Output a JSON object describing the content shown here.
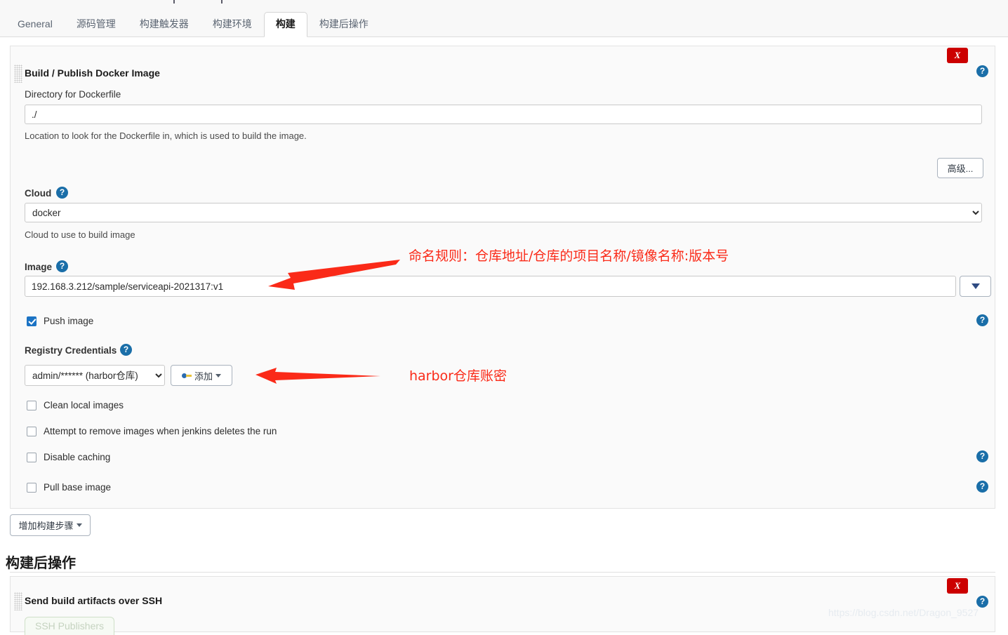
{
  "window": {
    "top_fragment_left": "|",
    "top_fragment_right": "|"
  },
  "tabs": [
    {
      "label": "General",
      "active": false
    },
    {
      "label": "源码管理",
      "active": false
    },
    {
      "label": "构建触发器",
      "active": false
    },
    {
      "label": "构建环境",
      "active": false
    },
    {
      "label": "构建",
      "active": true
    },
    {
      "label": "构建后操作",
      "active": false
    }
  ],
  "builder": {
    "title": "Build / Publish Docker Image",
    "delete_label": "X",
    "help_label": "?",
    "directory": {
      "label": "Directory for Dockerfile",
      "value": "./",
      "description": "Location to look for the Dockerfile in, which is used to build the image."
    },
    "advanced_button": "高级...",
    "cloud": {
      "label": "Cloud",
      "selected": "docker",
      "options": [
        "docker"
      ],
      "description": "Cloud to use to build image"
    },
    "image": {
      "label": "Image",
      "value": "192.168.3.212/sample/serviceapi-2021317:v1",
      "dropdown_label": "▼"
    },
    "push_image": {
      "label": "Push image",
      "checked": true
    },
    "registry_credentials": {
      "label": "Registry Credentials",
      "selected": "admin/****** (harbor仓库)",
      "options": [
        "admin/****** (harbor仓库)"
      ],
      "add_button": "添加"
    },
    "checkboxes": [
      {
        "label": "Clean local images",
        "checked": false,
        "has_help": false
      },
      {
        "label": "Attempt to remove images when jenkins deletes the run",
        "checked": false,
        "has_help": false
      },
      {
        "label": "Disable caching",
        "checked": false,
        "has_help": true
      },
      {
        "label": "Pull base image",
        "checked": false,
        "has_help": true
      }
    ]
  },
  "add_build_step_button": "增加构建步骤",
  "post_build": {
    "heading": "构建后操作",
    "panel_title": "Send build artifacts over SSH",
    "delete_label": "X",
    "help_label": "?",
    "publishers_tab": "SSH Publishers"
  },
  "annotations": [
    {
      "text": "命名规则：仓库地址/仓库的项目名称/镜像名称:版本号"
    },
    {
      "text": "harbor仓库账密"
    }
  ],
  "watermark": "https://blog.csdn.net/Dragon_9527",
  "colors": {
    "annotation_red": "#fa2a18",
    "help_blue": "#1a6ea8",
    "delete_red": "#cc0000",
    "checkbox_blue": "#1b73c4"
  }
}
